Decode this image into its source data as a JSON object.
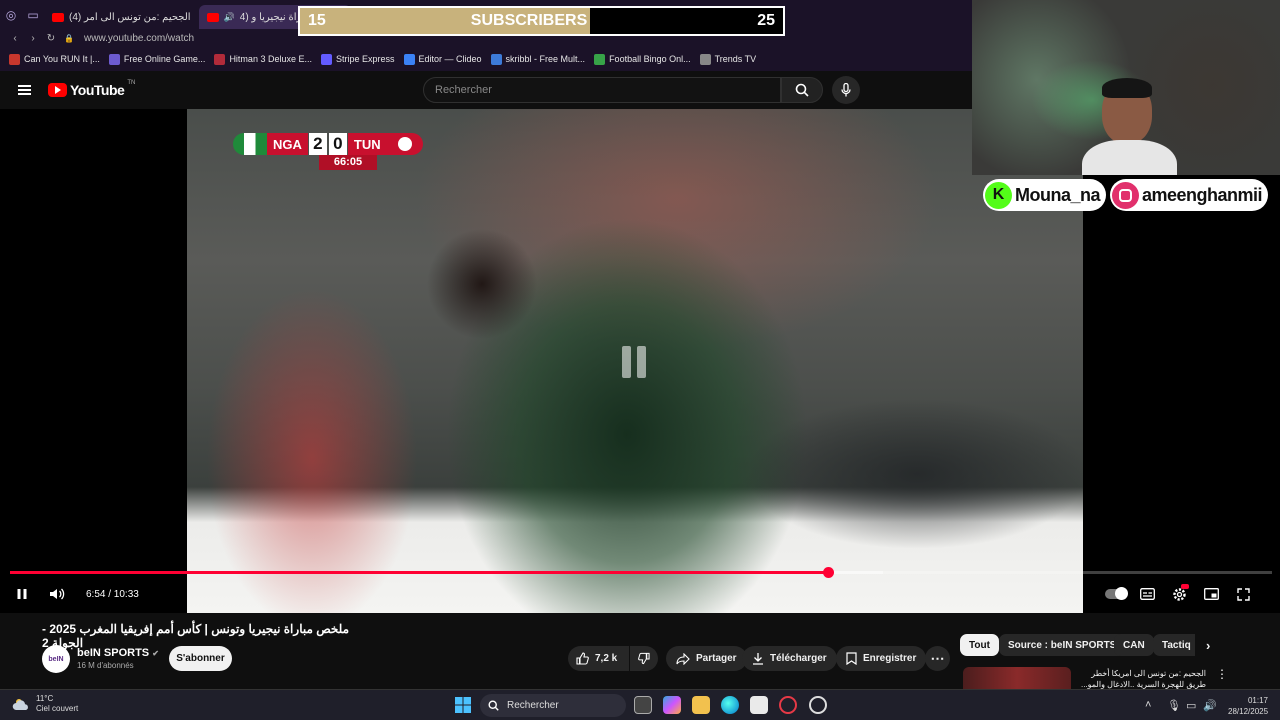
{
  "browser": {
    "tabs": [
      {
        "label": "الجحيم :من تونس الى امر (4)",
        "active": false
      },
      {
        "label": "ملخص مباراة نيجيريا و (4",
        "active": true
      }
    ],
    "url": "www.youtube.com/watch",
    "bookmarks": [
      {
        "label": "Can You RUN It |...",
        "color": "#c8372d"
      },
      {
        "label": "Free Online Game...",
        "color": "#6d5bd0"
      },
      {
        "label": "Hitman 3 Deluxe E...",
        "color": "#b22b3a"
      },
      {
        "label": "Stripe Express",
        "color": "#635bff"
      },
      {
        "label": "Editor — Clideo",
        "color": "#3b82f6"
      },
      {
        "label": "skribbl - Free Mult...",
        "color": "#3d7bd9"
      },
      {
        "label": "Football Bingo Onl...",
        "color": "#37a348"
      },
      {
        "label": "Trends TV",
        "color": "#888888"
      }
    ]
  },
  "stream_overlay": {
    "sub_goal": {
      "current": "15",
      "label": "SUBSCRIBERS",
      "target": "25",
      "progress": 0.6
    },
    "handles": [
      {
        "icon": "K",
        "name": "Mouna_na",
        "color": "#53fc18"
      },
      {
        "icon": "instagram-icon",
        "name": "ameenghanmii",
        "color": "#e1306c"
      }
    ]
  },
  "youtube": {
    "logo_text": "YouTube",
    "logo_tm": "TN",
    "search_placeholder": "Rechercher"
  },
  "video": {
    "scoreboard": {
      "home": "NGA",
      "home_score": "2",
      "away": "TUN",
      "away_score": "0",
      "clock": "66:05"
    },
    "time_label": "6:54 / 10:33",
    "progress": 0.648,
    "buffered": 0.692,
    "title": "ملخص مباراة نيجيريا وتونس | كأس أمم إفريقيا المغرب 2025 - الجولة 2"
  },
  "channel": {
    "avatar_text": "beIN",
    "name": "beIN SPORTS",
    "subscribers": "16 M d'abonnés",
    "subscribe_label": "S'abonner"
  },
  "actions": {
    "likes": "7,2 k",
    "share": "Partager",
    "download": "Télécharger",
    "save": "Enregistrer"
  },
  "chips": [
    "Tout",
    "Source : beIN SPORTS",
    "CAN",
    "Tactiq"
  ],
  "recommendation": {
    "title": "الجحيم :من تونس الى امريكا أخطر طريق للهجرة السرية ..الادغال والمو..."
  },
  "taskbar": {
    "weather_temp": "11°C",
    "weather_desc": "Ciel couvert",
    "search_label": "Rechercher",
    "time": "01:17",
    "date": "28/12/2025"
  }
}
